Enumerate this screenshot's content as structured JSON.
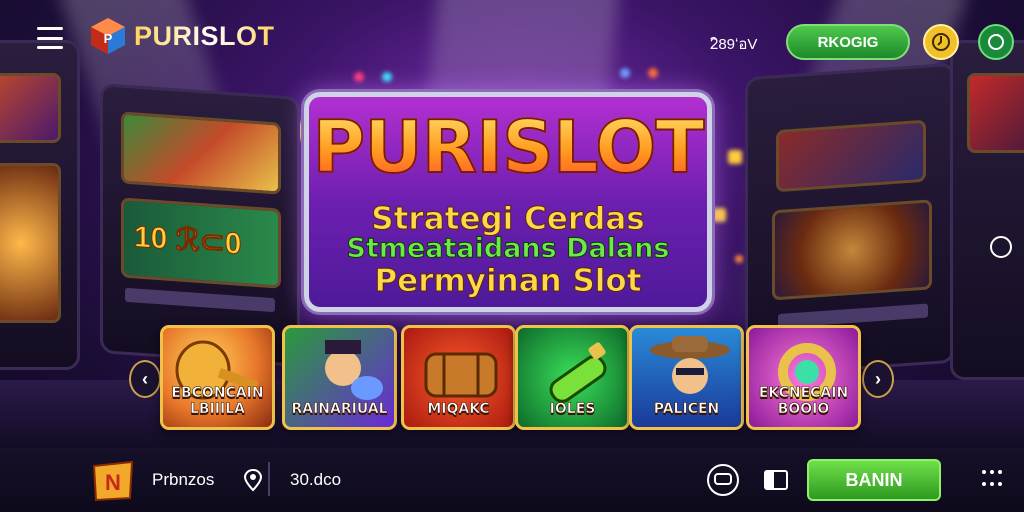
{
  "header": {
    "logo_text": "PURISLOT",
    "balance": "2ิ89ʻอV",
    "cta_label": "RKOGIG",
    "icons": [
      "menu-icon",
      "coin-icon",
      "refresh-icon"
    ]
  },
  "banner": {
    "title": "PURISLOT",
    "line1": "Strategi Cerdas",
    "line2": "Stmeataidans Dalans",
    "line3": "Permyinan Slot"
  },
  "carousel": {
    "prev_icon": "chevron-left-icon",
    "next_icon": "chevron-right-icon",
    "games": [
      {
        "label": "EBCONCAIN LBIIILA",
        "color": "#e8772a"
      },
      {
        "label": "RAINARIUAL",
        "color": "#2a9a3a"
      },
      {
        "label": "MIQAKC",
        "color": "#c42a1a"
      },
      {
        "label": "IOLES",
        "color": "#1e8a3a"
      },
      {
        "label": "PALICEN",
        "color": "#1a56c4"
      },
      {
        "label": "EKCNECAIN BOOIO",
        "color": "#c42aa8"
      }
    ]
  },
  "bottom": {
    "label": "Prbnzos",
    "value": "30.dco",
    "play_label": "BANIN",
    "icons": [
      "pin-icon",
      "chat-icon",
      "panel-icon",
      "more-icon"
    ]
  },
  "colors": {
    "accent_green": "#3cb43a",
    "gold": "#f1c24a",
    "bg": "#1b0d36"
  }
}
